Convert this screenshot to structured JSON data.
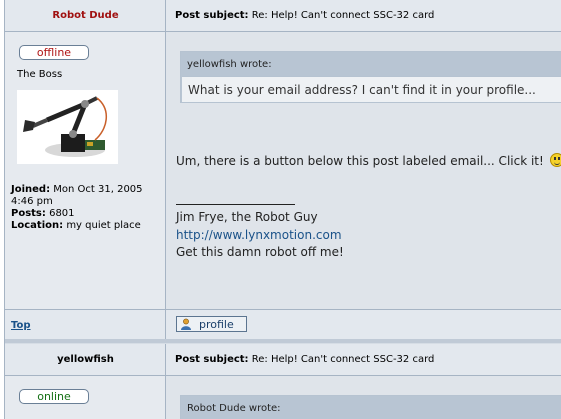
{
  "post1": {
    "author": "Robot Dude",
    "subject_label": "Post subject:",
    "subject": "Re: Help! Can't connect SSC-32 card",
    "status": "offline",
    "rank": "The Boss",
    "joined_label": "Joined:",
    "joined": "Mon Oct 31, 2005",
    "joined_time": "4:46 pm",
    "posts_label": "Posts:",
    "posts": "6801",
    "location_label": "Location:",
    "location": "my quiet place",
    "quote_author": "yellowfish wrote:",
    "quote_text": "What is your email address? I can't find it in your profile...",
    "message": "Um, there is a button below this post labeled email... Click it!",
    "sig_name": "Jim Frye, the Robot Guy",
    "sig_link": "http://www.lynxmotion.com",
    "sig_tagline": "Get this damn robot off me!",
    "top_link": "Top",
    "profile_button": "profile"
  },
  "post2": {
    "author": "yellowfish",
    "subject_label": "Post subject:",
    "subject": "Re: Help! Can't connect SSC-32 card",
    "status": "online",
    "quote_author": "Robot Dude wrote:"
  },
  "colors": {
    "author_red": "#a01010",
    "link_blue": "#1a5289",
    "offline": "#b01414",
    "online": "#137013"
  },
  "icons": [
    "robot-arm-avatar",
    "smiley-icon",
    "profile-icon"
  ]
}
